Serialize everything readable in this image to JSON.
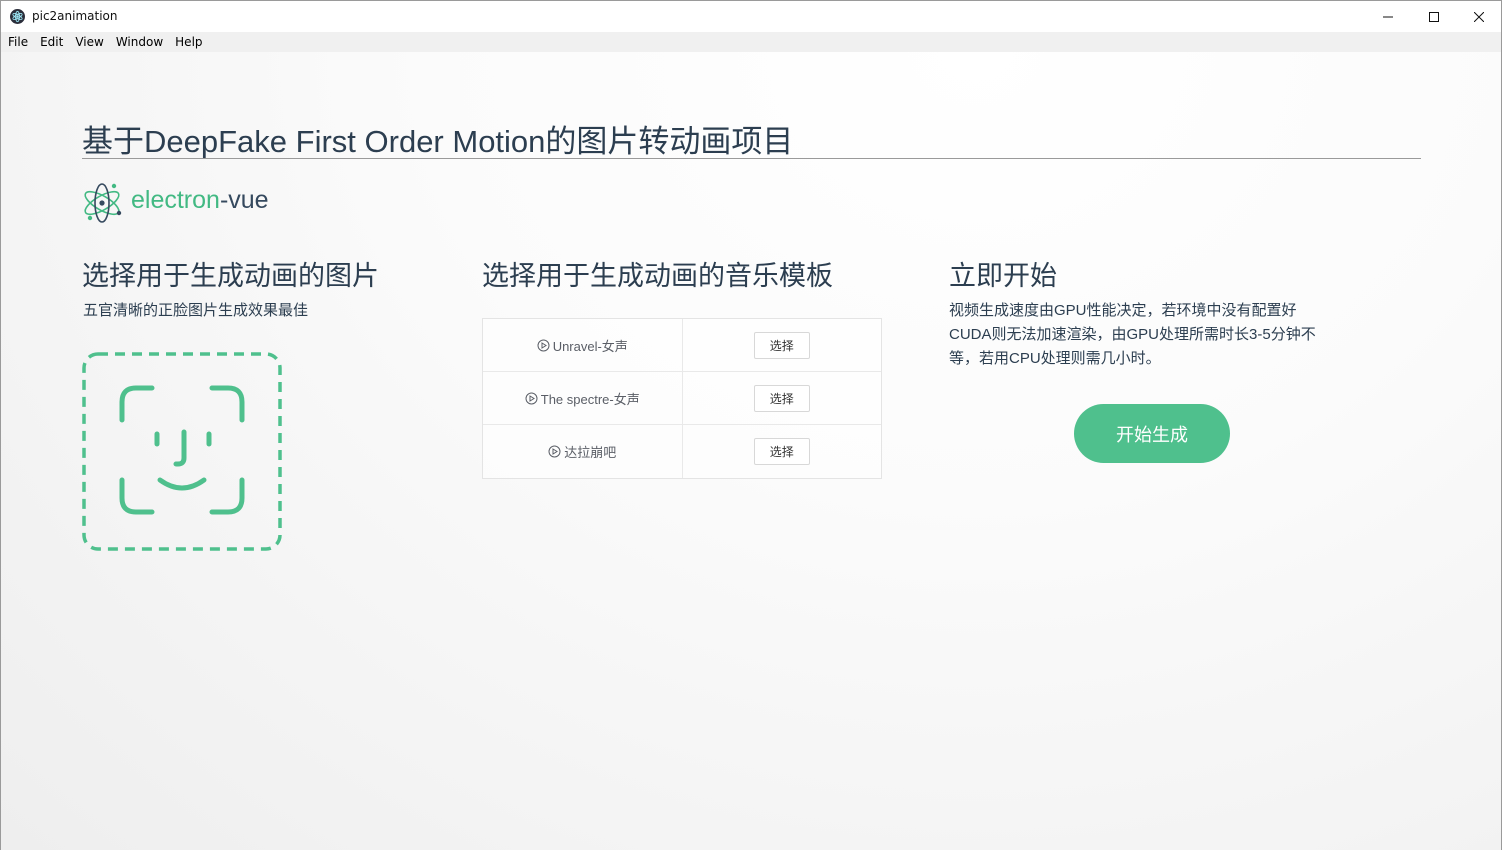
{
  "window": {
    "title": "pic2animation",
    "minimize_icon": "minimize-icon",
    "maximize_icon": "maximize-icon",
    "close_icon": "close-icon"
  },
  "menu": {
    "items": [
      "File",
      "Edit",
      "View",
      "Window",
      "Help"
    ]
  },
  "header": {
    "title": "基于DeepFake First Order Motion的图片转动画项目",
    "logo_text_a": "electron",
    "logo_text_b": "-vue"
  },
  "image_section": {
    "title": "选择用于生成动画的图片",
    "description": "五官清晰的正脸图片生成效果最佳",
    "upload_icon": "face-id-icon"
  },
  "music_section": {
    "title": "选择用于生成动画的音乐模板",
    "rows": [
      {
        "name": "Unravel-女声",
        "button": "选择"
      },
      {
        "name": "The spectre-女声",
        "button": "选择"
      },
      {
        "name": "达拉崩吧",
        "button": "选择"
      }
    ]
  },
  "start_section": {
    "title": "立即开始",
    "description_lines": [
      "视频生成速度由GPU性能决定，若环境中没有配置好",
      "CUDA则无法加速渲染，由GPU处理所需时长3-5分钟不",
      "等，若用CPU处理则需几小时。"
    ],
    "button": "开始生成"
  },
  "colors": {
    "accent": "#4fc08d",
    "text_dark": "#2c3e50",
    "face_icon": "#4fc08d"
  }
}
